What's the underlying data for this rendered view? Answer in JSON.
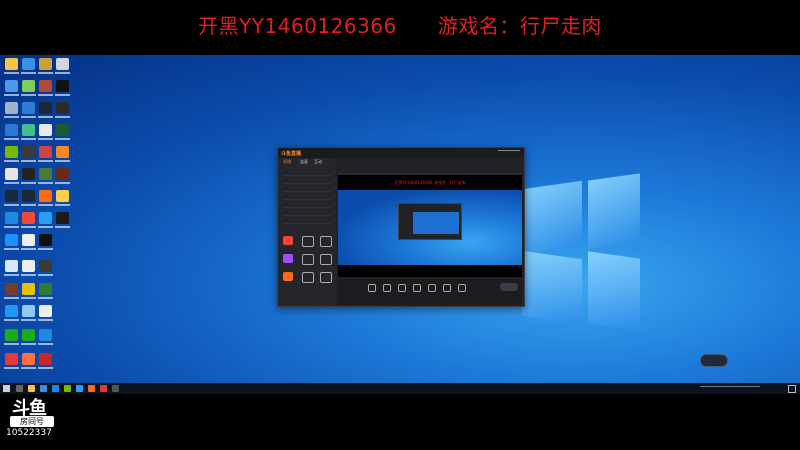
{
  "banner": {
    "text": "开黑YY1460126366      游戏名：行尸走肉"
  },
  "watermark": {
    "logo": "斗鱼",
    "sublabel": "房间号",
    "room_id": "10522337"
  },
  "capture_window": {
    "logo": "斗鱼直播",
    "tabs": [
      "直播",
      "连麦",
      "互动"
    ],
    "stage_banner": "开黑YY1460126366    游戏名：行尸走肉"
  },
  "colors": {
    "banner_red": "#e0201c",
    "desktop_blue": "#1d79d8",
    "taskbar": "#0c1422"
  }
}
